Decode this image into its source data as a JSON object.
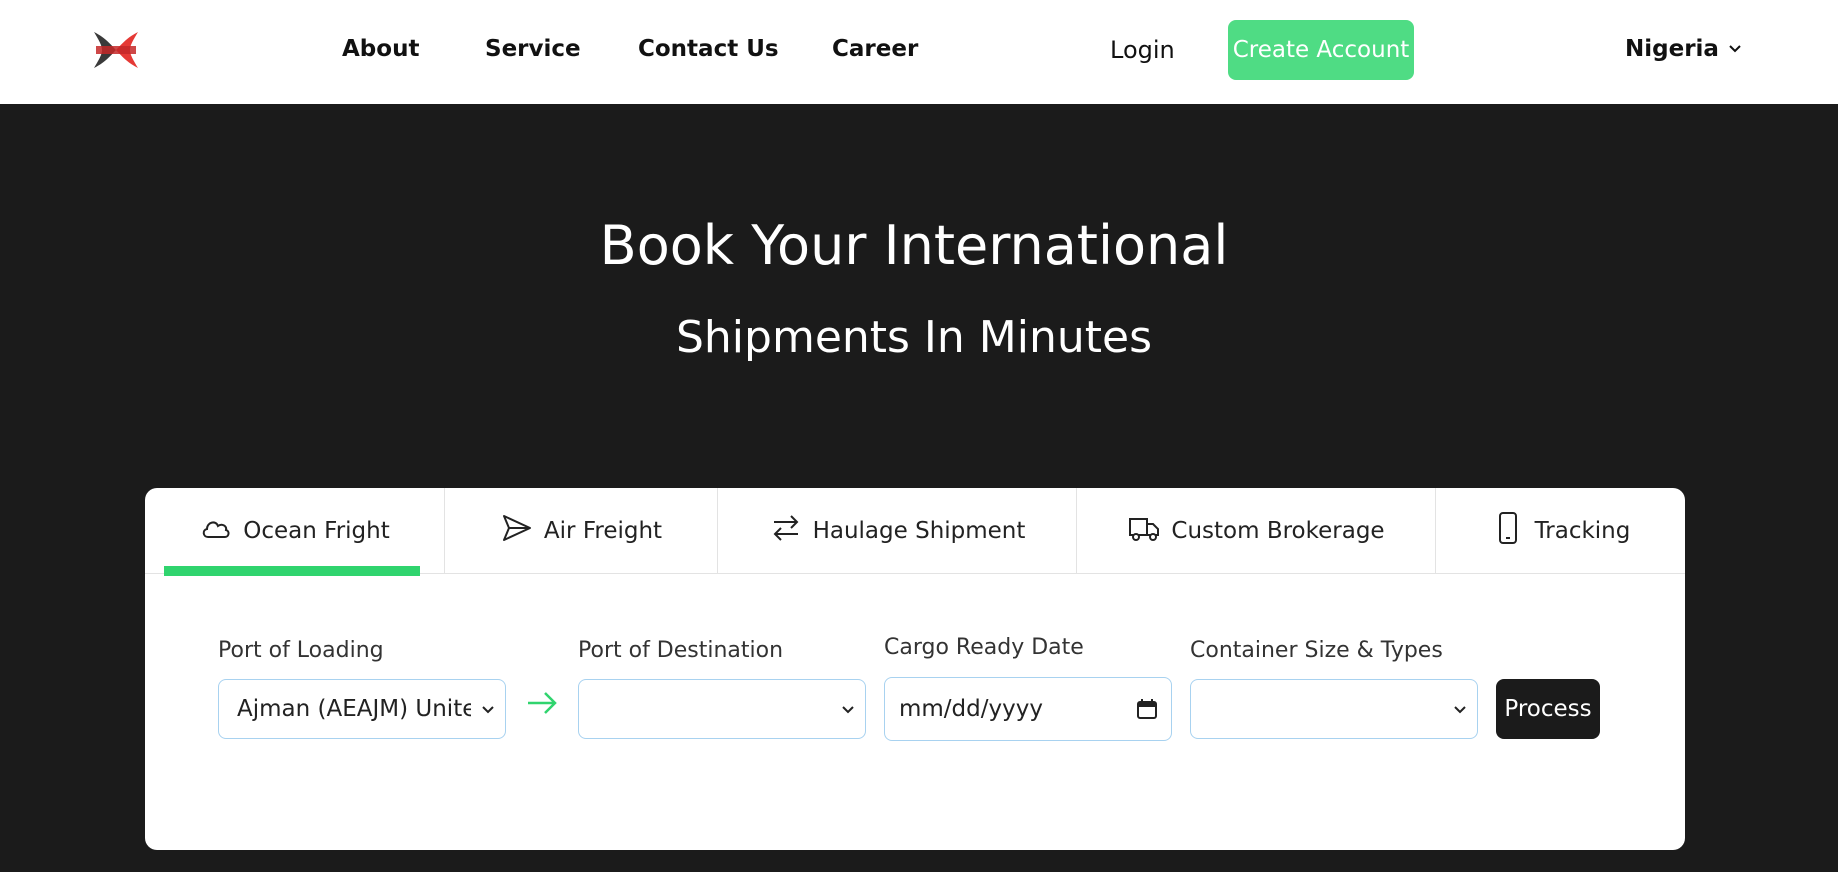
{
  "header": {
    "logo_name": "logo-icon",
    "nav": [
      {
        "label": "About"
      },
      {
        "label": "Service"
      },
      {
        "label": "Contact Us"
      },
      {
        "label": "Career"
      }
    ],
    "login_label": "Login",
    "create_account_label": "Create Account",
    "country": "Nigeria"
  },
  "hero": {
    "line1": "Book Your International",
    "line2": "Shipments In Minutes"
  },
  "tabs": [
    {
      "label": "Ocean Fright",
      "icon": "cloud-icon",
      "active": true
    },
    {
      "label": "Air Freight",
      "icon": "send-icon",
      "active": false
    },
    {
      "label": "Haulage Shipment",
      "icon": "swap-icon",
      "active": false
    },
    {
      "label": "Custom Brokerage",
      "icon": "truck-icon",
      "active": false
    },
    {
      "label": "Tracking",
      "icon": "phone-icon",
      "active": false
    }
  ],
  "form": {
    "port_loading_label": "Port of Loading",
    "port_loading_value": "Ajman (AEAJM) United Arab Emirates",
    "port_destination_label": "Port of Destination",
    "port_destination_value": "",
    "cargo_date_label": "Cargo Ready Date",
    "cargo_date_placeholder": "mm/dd/yyyy",
    "container_label": "Container Size & Types",
    "container_value": "",
    "process_label": "Process"
  },
  "colors": {
    "accent_green": "#4fdc84",
    "tab_indicator": "#30d46e",
    "dark_bg": "#1b1b1b",
    "input_border": "#a8d2f0"
  }
}
